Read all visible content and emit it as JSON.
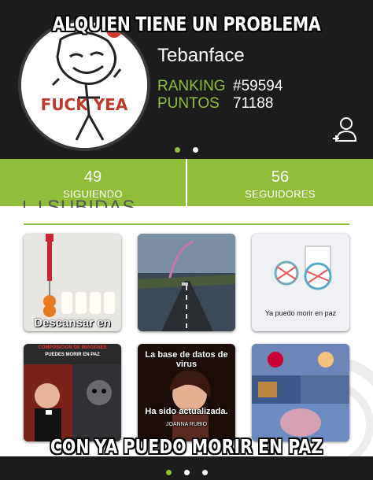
{
  "meme": {
    "top_text": "ALQUIEN TIENE UN PROBLEMA",
    "bottom_text": "CON YA PUEDO MORIR EN PAZ"
  },
  "profile": {
    "username": "Tebanface",
    "avatar_text": "FUCK YEA",
    "ranking_label": "RANKING",
    "ranking_value": "#59594",
    "points_label": "PUNTOS",
    "points_value": "71188",
    "add_user_icon": "add-user-icon"
  },
  "header_pager": {
    "count": 2,
    "active": 1
  },
  "counts": {
    "following_value": "49",
    "following_label": "SIGUIENDO",
    "followers_value": "56",
    "followers_label": "SEGUIDORES"
  },
  "section": {
    "title": "SUBIDAS",
    "icon": "upload-tray-icon"
  },
  "uploads": [
    {
      "caption": "Descansar en"
    },
    {
      "caption": ""
    },
    {
      "caption": "Ya puedo morir en paz"
    },
    {
      "caption": "COMPOSICION DE IMAGENES",
      "subcaption": "PUEDES MORIR EN PAZ"
    },
    {
      "caption": "La base de datos de virus",
      "subcaption": "Ha sido actualizada.",
      "footer": "JOANNA RUBIO"
    },
    {
      "caption": ""
    }
  ],
  "footer_pager": {
    "count": 3,
    "active": 1
  },
  "colors": {
    "accent": "#8fbf3a",
    "dark": "#1c1c1c",
    "white": "#ffffff"
  }
}
